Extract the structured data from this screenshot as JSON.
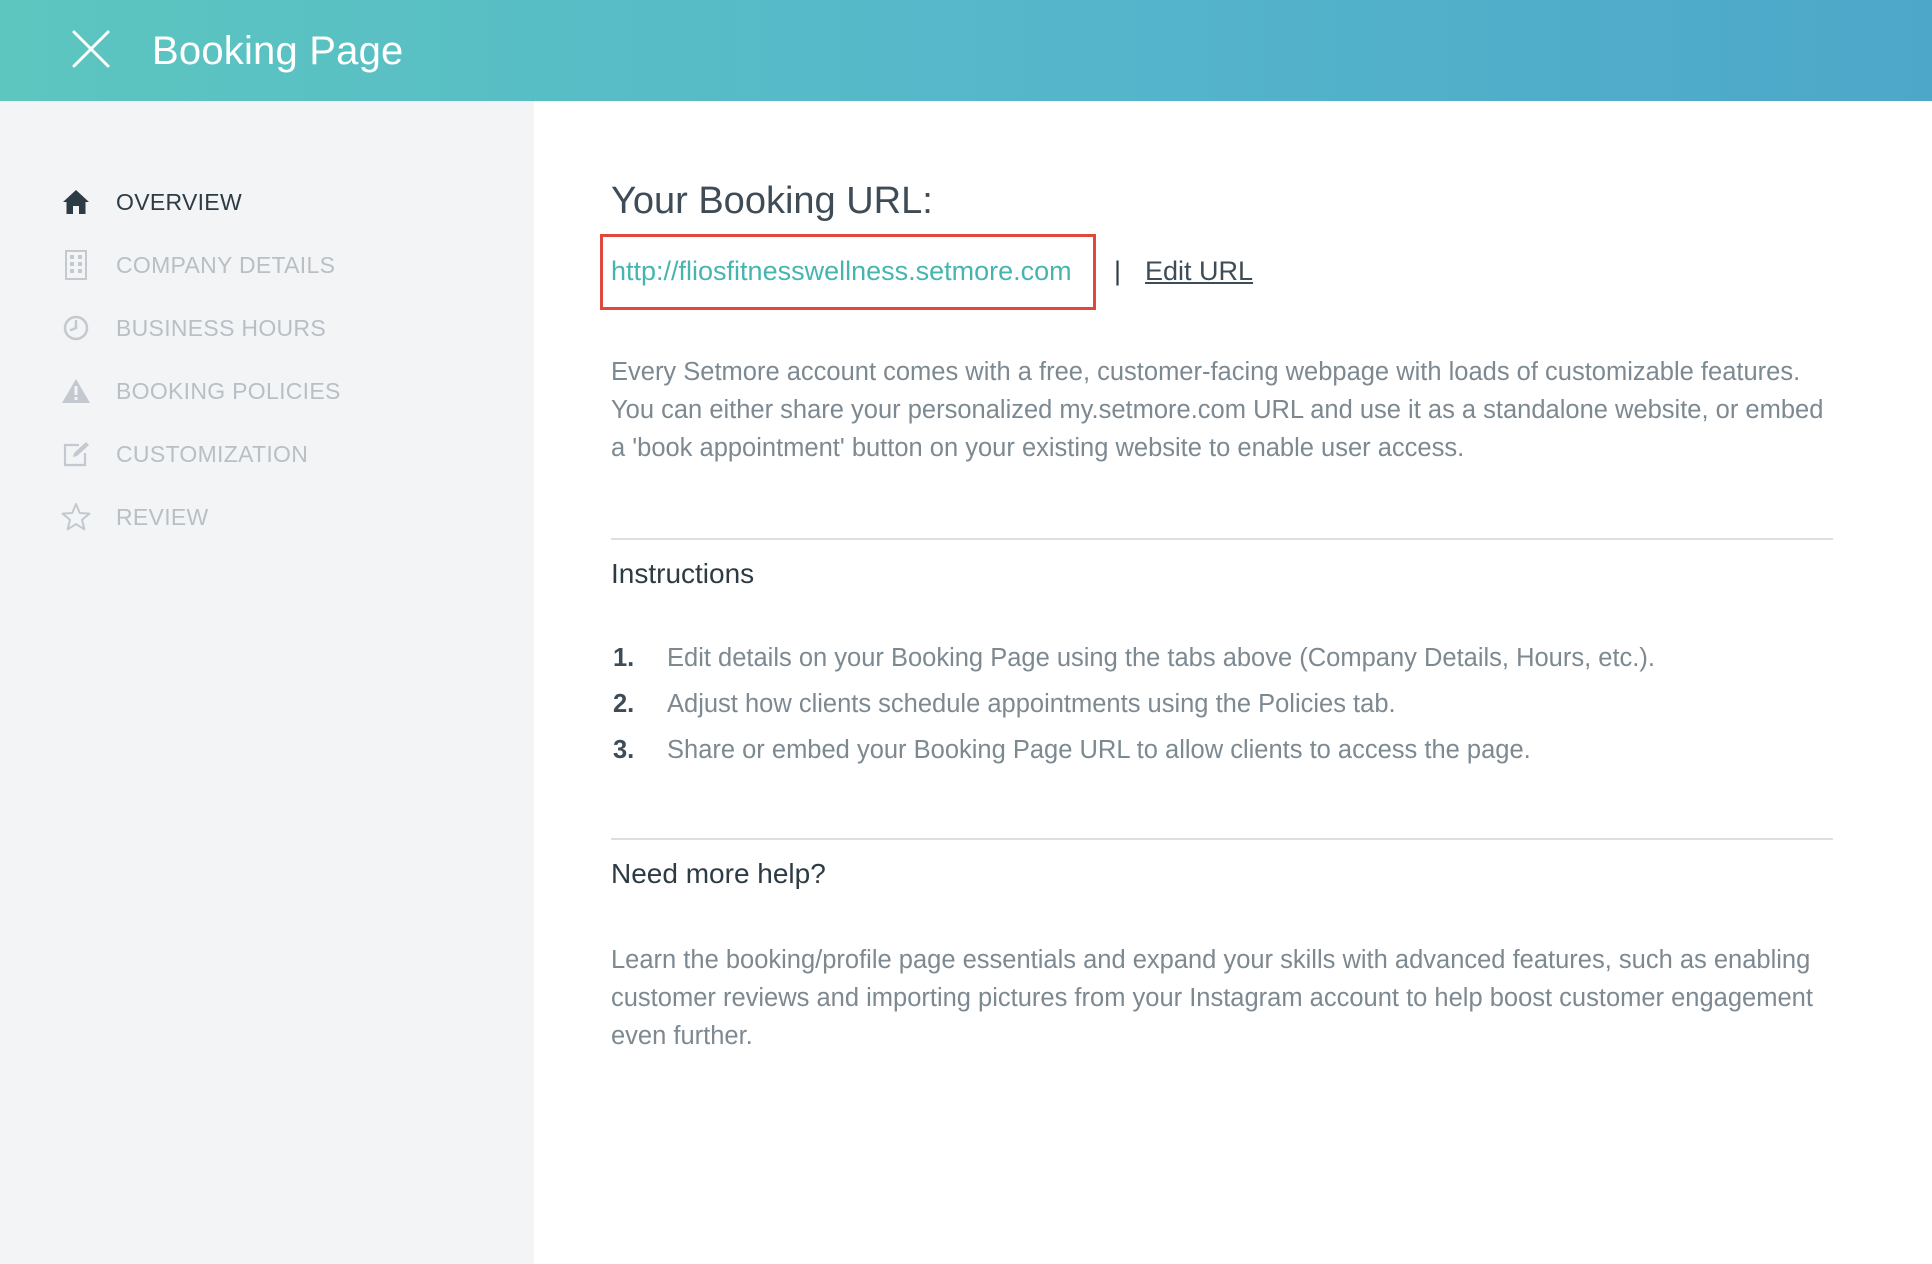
{
  "header": {
    "title": "Booking Page"
  },
  "sidebar": {
    "items": [
      {
        "label": "OVERVIEW",
        "icon": "home-icon",
        "active": true
      },
      {
        "label": "COMPANY DETAILS",
        "icon": "building-icon",
        "active": false
      },
      {
        "label": "BUSINESS HOURS",
        "icon": "clock-icon",
        "active": false
      },
      {
        "label": "BOOKING POLICIES",
        "icon": "warning-icon",
        "active": false
      },
      {
        "label": "CUSTOMIZATION",
        "icon": "edit-icon",
        "active": false
      },
      {
        "label": "REVIEW",
        "icon": "star-icon",
        "active": false
      }
    ]
  },
  "main": {
    "url_heading": "Your Booking URL:",
    "booking_url": "http://fliosfitnesswellness.setmore.com",
    "separator": "|",
    "edit_url_label": "Edit URL",
    "intro": "Every Setmore account comes with a free, customer-facing webpage with loads of customizable features. You can either share your personalized my.setmore.com URL and use it as a standalone website, or embed a 'book appointment' button on your existing website to enable user access.",
    "instructions": {
      "title": "Instructions",
      "steps": [
        {
          "num": "1.",
          "text": "Edit details on your Booking Page using the tabs above (Company Details, Hours, etc.)."
        },
        {
          "num": "2.",
          "text": "Adjust how clients schedule appointments using the Policies tab."
        },
        {
          "num": "3.",
          "text": "Share or embed your Booking Page URL to allow clients to access the page."
        }
      ]
    },
    "help": {
      "title": "Need more help?",
      "text": "Learn the booking/profile page essentials and expand your skills with advanced features, such as enabling customer reviews and importing pictures from your Instagram account to help boost customer engagement even further."
    }
  },
  "colors": {
    "header_gradient_start": "#5cc6bf",
    "header_gradient_end": "#4da7c9",
    "link": "#46b5b0",
    "highlight_box": "#e0483b",
    "sidebar_bg": "#f2f4f6"
  }
}
